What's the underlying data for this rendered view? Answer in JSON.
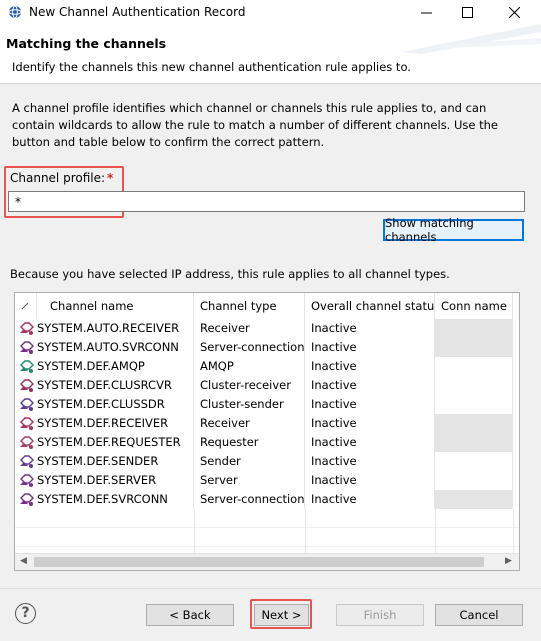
{
  "window": {
    "title": "New Channel Authentication Record"
  },
  "banner": {
    "title": "Matching the channels",
    "description": "Identify the channels this new channel authentication rule applies to."
  },
  "intro": "A channel profile identifies which channel or channels this rule applies to, and can contain wildcards to allow the rule to match a number of different channels. Use the button and table below to confirm the correct pattern.",
  "profile": {
    "label": "Channel profile:",
    "required_mark": "*",
    "value": "*"
  },
  "show_button": "Show matching channels",
  "note": "Because you have selected IP address, this rule applies to all channel types.",
  "table": {
    "columns": [
      "Channel name",
      "Channel type",
      "Overall channel status",
      "Conn name"
    ],
    "rows": [
      {
        "name": "SYSTEM.AUTO.RECEIVER",
        "type": "Receiver",
        "status": "Inactive",
        "icon": "receiver-channel-icon"
      },
      {
        "name": "SYSTEM.AUTO.SVRCONN",
        "type": "Server-connection",
        "status": "Inactive",
        "icon": "server-connection-channel-icon"
      },
      {
        "name": "SYSTEM.DEF.AMQP",
        "type": "AMQP",
        "status": "Inactive",
        "icon": "amqp-channel-icon"
      },
      {
        "name": "SYSTEM.DEF.CLUSRCVR",
        "type": "Cluster-receiver",
        "status": "Inactive",
        "icon": "cluster-receiver-channel-icon"
      },
      {
        "name": "SYSTEM.DEF.CLUSSDR",
        "type": "Cluster-sender",
        "status": "Inactive",
        "icon": "cluster-sender-channel-icon"
      },
      {
        "name": "SYSTEM.DEF.RECEIVER",
        "type": "Receiver",
        "status": "Inactive",
        "icon": "receiver-channel-icon"
      },
      {
        "name": "SYSTEM.DEF.REQUESTER",
        "type": "Requester",
        "status": "Inactive",
        "icon": "requester-channel-icon"
      },
      {
        "name": "SYSTEM.DEF.SENDER",
        "type": "Sender",
        "status": "Inactive",
        "icon": "sender-channel-icon"
      },
      {
        "name": "SYSTEM.DEF.SERVER",
        "type": "Server",
        "status": "Inactive",
        "icon": "server-channel-icon"
      },
      {
        "name": "SYSTEM.DEF.SVRCONN",
        "type": "Server-connection",
        "status": "Inactive",
        "icon": "server-connection-channel-icon"
      }
    ]
  },
  "buttons": {
    "back": "< Back",
    "next": "Next >",
    "finish": "Finish",
    "cancel": "Cancel"
  },
  "colors": {
    "highlight_red": "#e8544e",
    "focus_blue": "#0078d7",
    "required_red": "#d0291e"
  }
}
